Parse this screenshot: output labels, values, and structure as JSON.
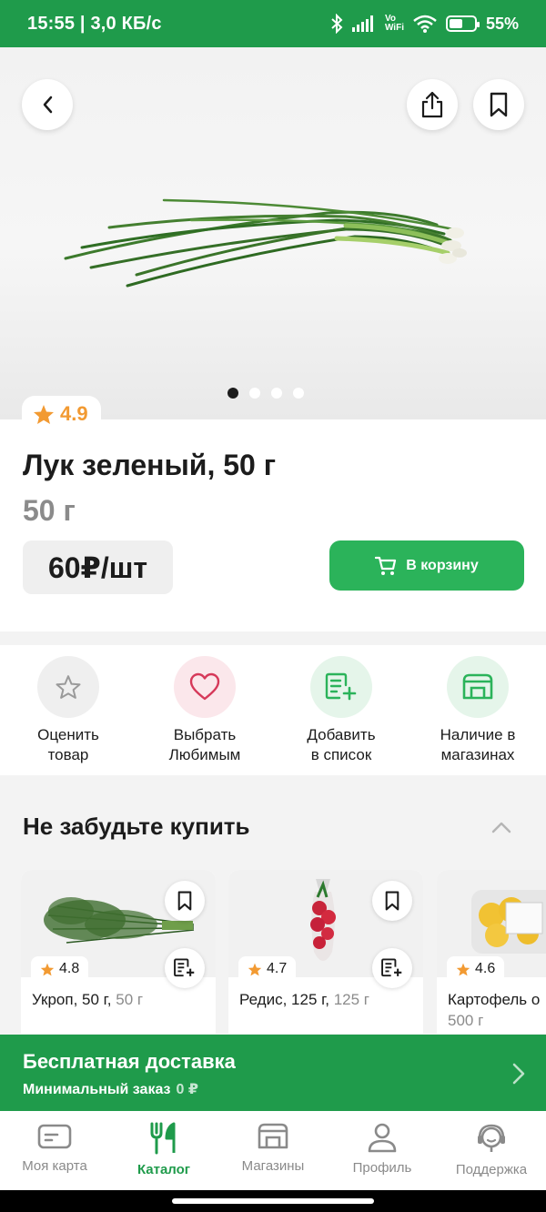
{
  "status_bar": {
    "time_speed": "15:55 | 3,0 КБ/с",
    "vowifi_top": "Vo",
    "vowifi_bottom": "WiFi",
    "battery": "55%",
    "battery_level": 0.55
  },
  "gallery": {
    "total_images": 4,
    "active_index": 0
  },
  "product": {
    "rating": "4.9",
    "title": "Лук зеленый, 50 г",
    "weight": "50 г",
    "price": "60₽/шт",
    "cart_button": "В корзину"
  },
  "actions": [
    {
      "label": "Оценить\nтовар",
      "icon": "star-outline-icon",
      "color": "#1c1c1c"
    },
    {
      "label": "Выбрать\nЛюбимым",
      "icon": "heart-icon",
      "color": "#8b8b8b"
    },
    {
      "label": "Добавить\nв список",
      "icon": "list-add-icon",
      "color": "#1c1c1c"
    },
    {
      "label": "Наличие в\nмагазинах",
      "icon": "store-icon",
      "color": "#8b8b8b"
    }
  ],
  "recommend": {
    "title": "Не забудьте купить",
    "items": [
      {
        "rating": "4.8",
        "name": "Укроп, 50 г,",
        "weight": "50 г"
      },
      {
        "rating": "4.7",
        "name": "Редис, 125 г,",
        "weight": "125 г"
      },
      {
        "rating": "4.6",
        "name": "Картофель о",
        "weight": "500 г"
      }
    ]
  },
  "delivery": {
    "title": "Бесплатная доставка",
    "min_label": "Минимальный заказ",
    "min_amount": "0 ₽"
  },
  "tabs": [
    {
      "label": "Моя карта",
      "icon": "card-icon",
      "active": false
    },
    {
      "label": "Каталог",
      "icon": "catalog-fork-knife-icon",
      "active": true
    },
    {
      "label": "Магазины",
      "icon": "store-icon",
      "active": false
    },
    {
      "label": "Профиль",
      "icon": "profile-icon",
      "active": false
    },
    {
      "label": "Поддержка",
      "icon": "support-headset-icon",
      "active": false
    }
  ],
  "colors": {
    "brand_green": "#1f9b4b",
    "button_green": "#2bb35a",
    "star_orange": "#f29a32",
    "heart_pink": "#d6395a"
  }
}
